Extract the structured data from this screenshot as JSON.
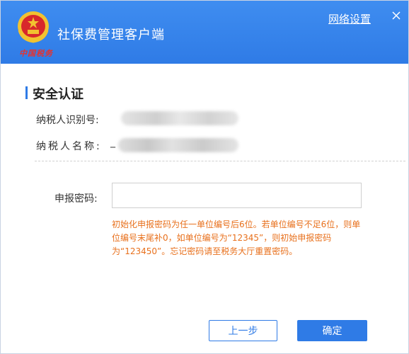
{
  "header": {
    "app_title": "社保费管理客户端",
    "logo_text": "中国税务",
    "network_settings_label": "网络设置",
    "close_symbol": "×"
  },
  "section": {
    "title": "安全认证"
  },
  "taxpayer": {
    "id_label": "纳税人识别号:",
    "name_label": "纳税人名称:",
    "name_prefix": "_"
  },
  "password": {
    "label": "申报密码:",
    "value": "",
    "hint": "初始化申报密码为任一单位编号后6位。若单位编号不足6位，则单位编号末尾补0，如单位编号为“12345”，则初始申报密码为“123450”。忘记密码请至税务大厅重置密码。"
  },
  "buttons": {
    "prev_label": "上一步",
    "ok_label": "确定"
  },
  "colors": {
    "header_blue": "#2f7be6",
    "hint_orange": "#e8701c",
    "logo_red": "#e8312c"
  }
}
